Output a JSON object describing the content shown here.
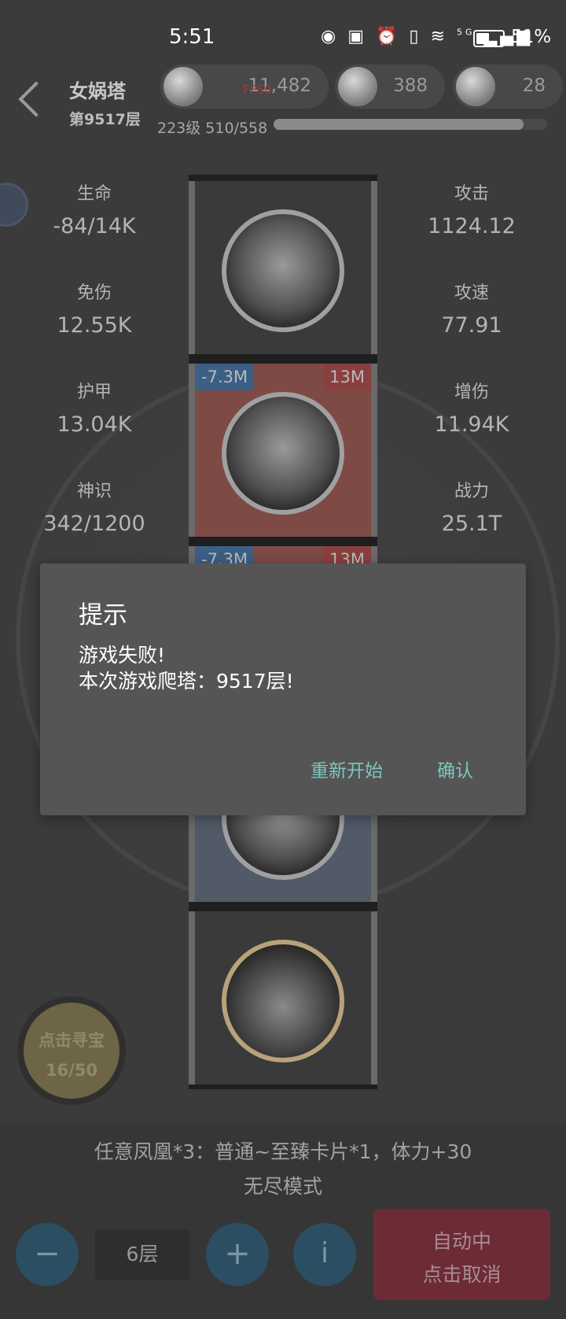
{
  "status_bar": {
    "time": "5:51",
    "network": "5G",
    "battery": "51%"
  },
  "header": {
    "title": "女娲塔",
    "subtitle": "第9517层",
    "currencies": [
      {
        "icon": "heart-icon",
        "value": "11,482"
      },
      {
        "icon": "coin-icon",
        "value": "388"
      },
      {
        "icon": "diamond-icon",
        "value": "28"
      }
    ],
    "fps": "FPS0",
    "level": "223级 510/558",
    "xp_fraction": 0.914
  },
  "stats_left": [
    {
      "label": "生命",
      "value": "-84/14K"
    },
    {
      "label": "免伤",
      "value": "12.55K"
    },
    {
      "label": "护甲",
      "value": "13.04K"
    },
    {
      "label": "神识",
      "value": "342/1200"
    }
  ],
  "stats_right": [
    {
      "label": "攻击",
      "value": "1124.12"
    },
    {
      "label": "攻速",
      "value": "77.91"
    },
    {
      "label": "增伤",
      "value": "11.94K"
    },
    {
      "label": "战力",
      "value": "25.1T"
    }
  ],
  "cards": [
    {
      "tag_left": "",
      "tag_right": ""
    },
    {
      "tag_left": "-7.3M",
      "tag_right": "13M"
    },
    {
      "tag_left": "-7.3M",
      "tag_right": "13M"
    }
  ],
  "dialog": {
    "title": "提示",
    "line1": "游戏失败!",
    "line2": "本次游戏爬塔：9517层!",
    "restart": "重新开始",
    "confirm": "确认"
  },
  "treasure": {
    "label": "点击寻宝",
    "count": "16/50"
  },
  "bottom": {
    "reward": "任意凤凰*3：普通~至臻卡片*1，体力+30",
    "mode": "无尽模式",
    "minus": "−",
    "floors": "6层",
    "plus": "+",
    "info": "i",
    "auto_line1": "自动中",
    "auto_line2": "点击取消"
  }
}
